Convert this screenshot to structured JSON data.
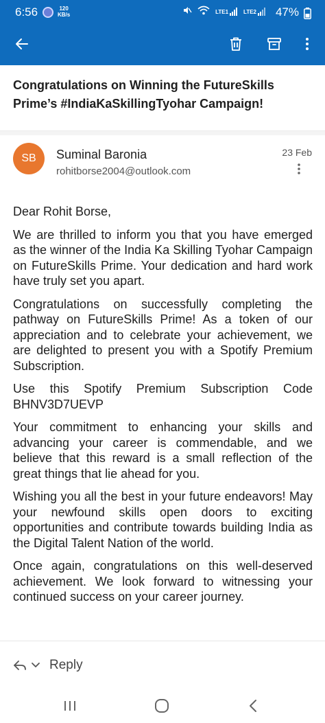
{
  "status_bar": {
    "time": "6:56",
    "speed_value": "120",
    "speed_unit": "KB/s",
    "battery": "47%",
    "lte1": "LTE1",
    "lte2": "LTE2"
  },
  "app_bar": {
    "background_color": "#0f6cbd",
    "icons": [
      "back-arrow-icon",
      "trash-icon",
      "archive-icon",
      "more-vertical-icon"
    ]
  },
  "email": {
    "subject": "Congratulations on Winning the FutureSkills Prime’s #IndiaKaSkillingTyohar Campaign!",
    "sender": {
      "initials": "SB",
      "avatar_color": "#e8772e",
      "name": "Suminal Baronia",
      "email": "rohitborse2004@outlook.com"
    },
    "date": "23 Feb",
    "greeting": "Dear Rohit Borse,",
    "paragraphs": [
      "We are thrilled to inform you that you have emerged as the winner of the India Ka Skilling Tyohar Campaign on FutureSkills Prime. Your dedication and hard work have truly set you apart.",
      "Congratulations on successfully completing the pathway on FutureSkills Prime! As a token of our appreciation and to celebrate your achievement, we are delighted to present you with a Spotify Premium Subscription.",
      "Use this Spotify Premium Subscription Code BHNV3D7UEVP",
      "Your commitment to enhancing your skills and advancing your career is commendable, and we believe that this reward is a small reflection of the great things that lie ahead for you.",
      "Wishing you all the best in your future endeavors! May your newfound skills open doors to exciting opportunities and contribute towards building India as the Digital Talent Nation of the world.",
      "Once again, congratulations on this well-deserved achievement. We look forward to witnessing your continued success on your career journey."
    ]
  },
  "reply_bar": {
    "label": "Reply"
  }
}
